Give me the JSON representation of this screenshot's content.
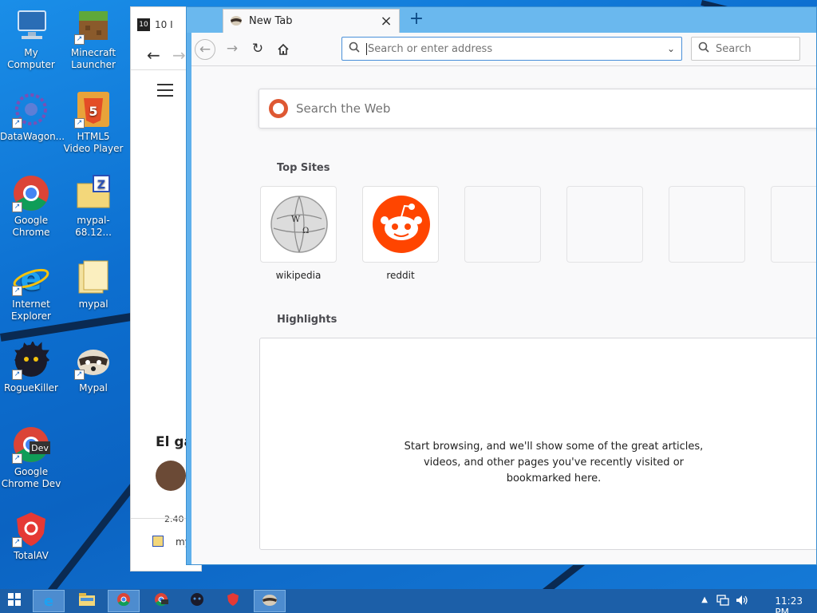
{
  "desktop": {
    "icons": [
      {
        "label": "My Computer"
      },
      {
        "label": "Minecraft Launcher"
      },
      {
        "label": "DataWagon..."
      },
      {
        "label": "HTML5 Video Player"
      },
      {
        "label": "Google Chrome"
      },
      {
        "label": "mypal-68.12..."
      },
      {
        "label": "Internet Explorer"
      },
      {
        "label": "mypal"
      },
      {
        "label": "RogueKiller"
      },
      {
        "label": "Mypal"
      },
      {
        "label": "Google Chrome Dev"
      },
      {
        "label": "TotalAV"
      }
    ]
  },
  "bg_window": {
    "tab_text": "10 I",
    "heading": "El ga",
    "bottom_text": "my",
    "count": "2.40"
  },
  "browser": {
    "tab": {
      "title": "New Tab",
      "close": "×"
    },
    "new_tab": "+",
    "urlbar": {
      "placeholder": "Search or enter address"
    },
    "searchbar": {
      "placeholder": "Search"
    },
    "websearch": {
      "placeholder": "Search the Web"
    },
    "top_sites": {
      "title": "Top Sites",
      "tiles": [
        {
          "label": "wikipedia"
        },
        {
          "label": "reddit"
        }
      ]
    },
    "highlights": {
      "title": "Highlights",
      "empty_message": "Start browsing, and we'll show some of the great articles, videos, and other pages you've recently visited or bookmarked here."
    }
  },
  "taskbar": {
    "clock": "11:23 PM"
  },
  "colors": {
    "taskbar": "#1c5fa8",
    "browser_frame": "#5fb0ec",
    "reddit": "#ff4500"
  }
}
